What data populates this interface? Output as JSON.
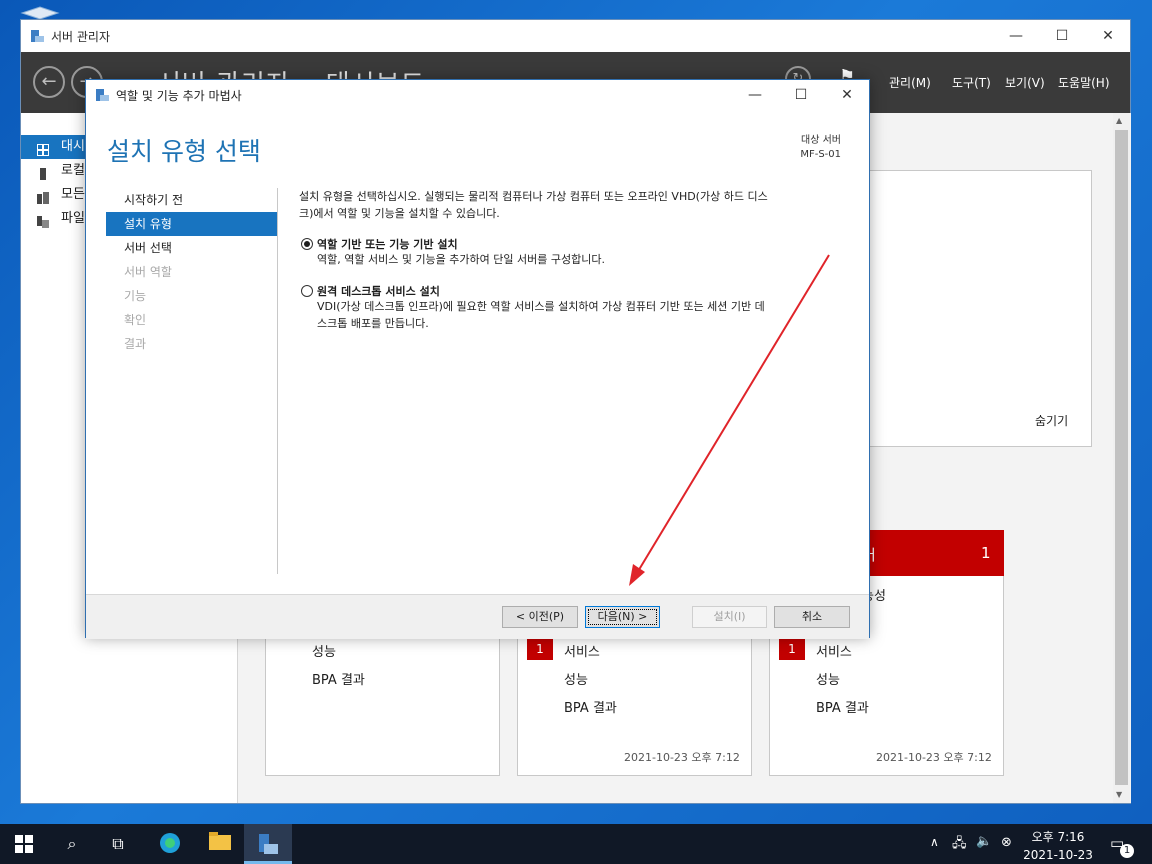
{
  "server_manager": {
    "window_title": "서버 관리자",
    "header_title": "서버 관리자 • 대시보드",
    "menu": [
      "관리(M)",
      "도구(T)",
      "보기(V)",
      "도움말(H)"
    ],
    "sidebar": [
      {
        "label": "대시보드",
        "icon": "dashboard-icon"
      },
      {
        "label": "로컬 서버",
        "icon": "local-server-icon"
      },
      {
        "label": "모든 서버",
        "icon": "all-servers-icon"
      },
      {
        "label": "파일 및 저장소 서비스",
        "icon": "file-services-icon"
      }
    ],
    "hide_label": "숨기기",
    "tiles": [
      {
        "head": "",
        "count": "",
        "items": [
          "성능",
          "BPA 결과"
        ],
        "date": ""
      },
      {
        "head": "",
        "count": "",
        "badge": "1",
        "items": [
          "서비스",
          "성능",
          "BPA 결과"
        ],
        "date": "2021-10-23 오후 7:12"
      },
      {
        "head": "버",
        "count": "1",
        "sub": "능성",
        "badge": "1",
        "items": [
          "서비스",
          "성능",
          "BPA 결과"
        ],
        "date": "2021-10-23 오후 7:12"
      }
    ]
  },
  "wizard": {
    "title": "역할 및 기능 추가 마법사",
    "heading": "설치 유형 선택",
    "dest_label": "대상 서버",
    "dest_server": "MF-S-01",
    "steps": [
      {
        "label": "시작하기 전",
        "state": "done"
      },
      {
        "label": "설치 유형",
        "state": "current"
      },
      {
        "label": "서버 선택",
        "state": "enabled"
      },
      {
        "label": "서버 역할",
        "state": "disabled"
      },
      {
        "label": "기능",
        "state": "disabled"
      },
      {
        "label": "확인",
        "state": "disabled"
      },
      {
        "label": "결과",
        "state": "disabled"
      }
    ],
    "intro_line1": "설치 유형을 선택하십시오. 실행되는 물리적 컴퓨터나 가상 컴퓨터 또는 오프라인 VHD(가상 하드 디스",
    "intro_line2": "크)에서 역할 및 기능을 설치할 수 있습니다.",
    "option1_title": "역할 기반 또는 기능 기반 설치",
    "option1_desc": "역할, 역할 서비스 및 기능을 추가하여 단일 서버를 구성합니다.",
    "option1_selected": true,
    "option2_title": "원격 데스크톱 서비스 설치",
    "option2_desc1": "VDI(가상 데스크톱 인프라)에 필요한 역할 서비스를 설치하여 가상 컴퓨터 기반 또는 세션 기반 데",
    "option2_desc2": "스크톱 배포를 만듭니다.",
    "buttons": {
      "prev": "< 이전(P)",
      "next": "다음(N) >",
      "install": "설치(I)",
      "cancel": "취소"
    }
  },
  "taskbar": {
    "time": "오후 7:16",
    "date": "2021-10-23",
    "notification_count": "1"
  },
  "colors": {
    "accent": "#1874c0",
    "alert": "#c20000",
    "annotation_arrow": "#e0242a"
  }
}
